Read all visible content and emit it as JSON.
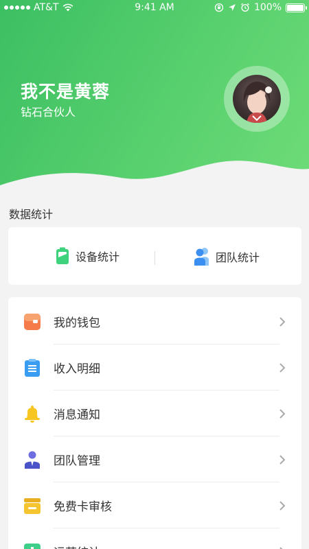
{
  "status_bar": {
    "carrier": "AT&T",
    "time": "9:41 AM",
    "battery": "100%"
  },
  "profile": {
    "name": "我不是黄蓉",
    "level": "钻石合伙人"
  },
  "section_title": "数据统计",
  "stats": {
    "device_label": "设备统计",
    "team_label": "团队统计"
  },
  "menu": {
    "items": [
      {
        "label": "我的钱包",
        "icon": "wallet-icon",
        "color": "#f57c4a"
      },
      {
        "label": "收入明细",
        "icon": "clipboard-icon",
        "color": "#3b9df2"
      },
      {
        "label": "消息通知",
        "icon": "bell-icon",
        "color": "#f7c623"
      },
      {
        "label": "团队管理",
        "icon": "manager-icon",
        "color": "#4b53c9"
      },
      {
        "label": "免费卡审核",
        "icon": "card-stack-icon",
        "color": "#f4c531"
      },
      {
        "label": "运营统计",
        "icon": "chart-icon",
        "color": "#3fcf8a"
      }
    ]
  },
  "colors": {
    "header_start": "#3cbf62",
    "header_end": "#6fdc78",
    "background": "#f3f3f3"
  }
}
